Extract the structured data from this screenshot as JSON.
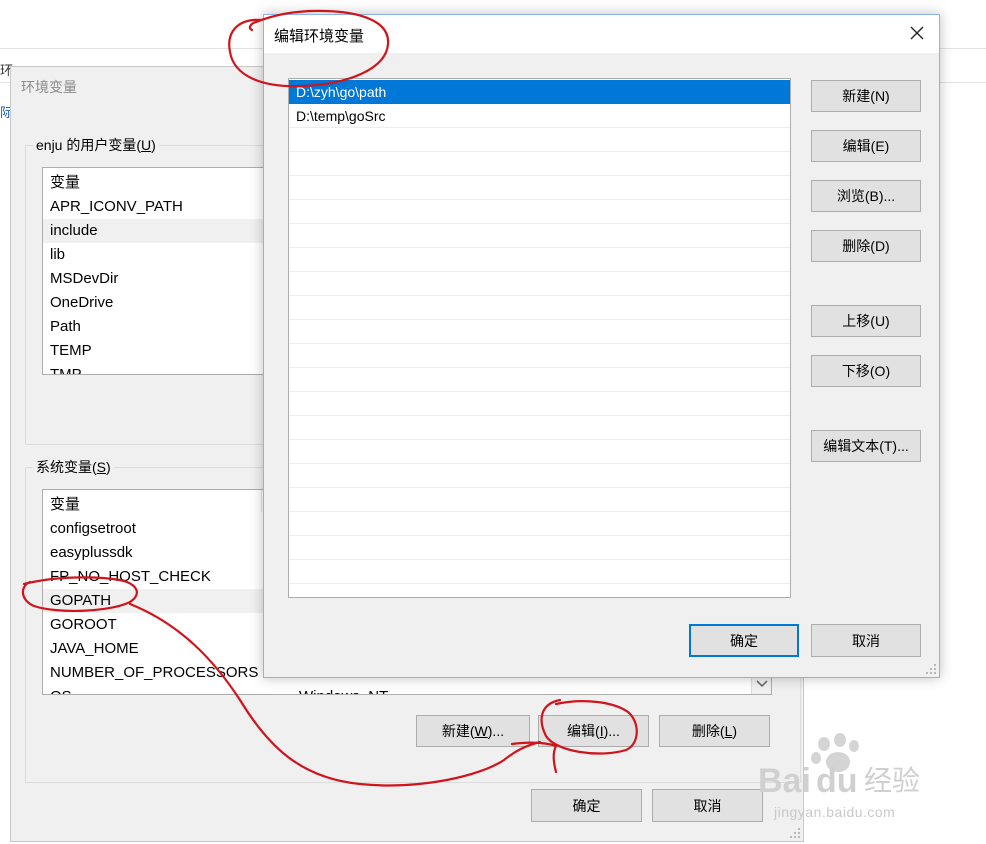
{
  "background": {
    "left_glyph_top": "环",
    "left_glyph_mid": "际"
  },
  "env_dialog": {
    "title": "环境变量",
    "user_group": {
      "label_prefix": "enju 的用户变量(",
      "label_key": "U",
      "label_suffix": ")",
      "header": "变量",
      "rows": [
        "APR_ICONV_PATH",
        "include",
        "lib",
        "MSDevDir",
        "OneDrive",
        "Path",
        "TEMP",
        "TMP"
      ]
    },
    "system_group": {
      "label_prefix": "系统变量(",
      "label_key": "S",
      "label_suffix": ")",
      "header": "变量",
      "rows": [
        "configsetroot",
        "easyplussdk",
        "FP_NO_HOST_CHECK",
        "GOPATH",
        "GOROOT",
        "JAVA_HOME",
        "NUMBER_OF_PROCESSORS",
        "OS"
      ],
      "partial_value": "Windows_NT"
    },
    "buttons": {
      "new_prefix": "新建(",
      "new_key": "W",
      "new_suffix": ")...",
      "edit_prefix": "编辑(",
      "edit_key": "I",
      "edit_suffix": ")...",
      "delete_prefix": "删除(",
      "delete_key": "L",
      "delete_suffix": ")",
      "ok": "确定",
      "cancel": "取消"
    }
  },
  "edit_dialog": {
    "title": "编辑环境变量",
    "paths": [
      "D:\\zyh\\go\\path",
      "D:\\temp\\goSrc"
    ],
    "selected_index": 0,
    "buttons": {
      "new": "新建(N)",
      "edit": "编辑(E)",
      "browse": "浏览(B)...",
      "delete": "删除(D)",
      "move_up": "上移(U)",
      "move_down": "下移(O)",
      "edit_text": "编辑文本(T)...",
      "ok": "确定",
      "cancel": "取消"
    }
  },
  "watermark": {
    "brand_a": "Bai",
    "brand_b": "du",
    "brand_cn": "经验",
    "url": "jingyan.baidu.com"
  },
  "icons": {
    "close": "close-icon",
    "scroll_down": "chevron-down-icon",
    "paw": "paw-icon"
  },
  "colors": {
    "accent": "#0078d7",
    "annotation": "#d0141b"
  }
}
